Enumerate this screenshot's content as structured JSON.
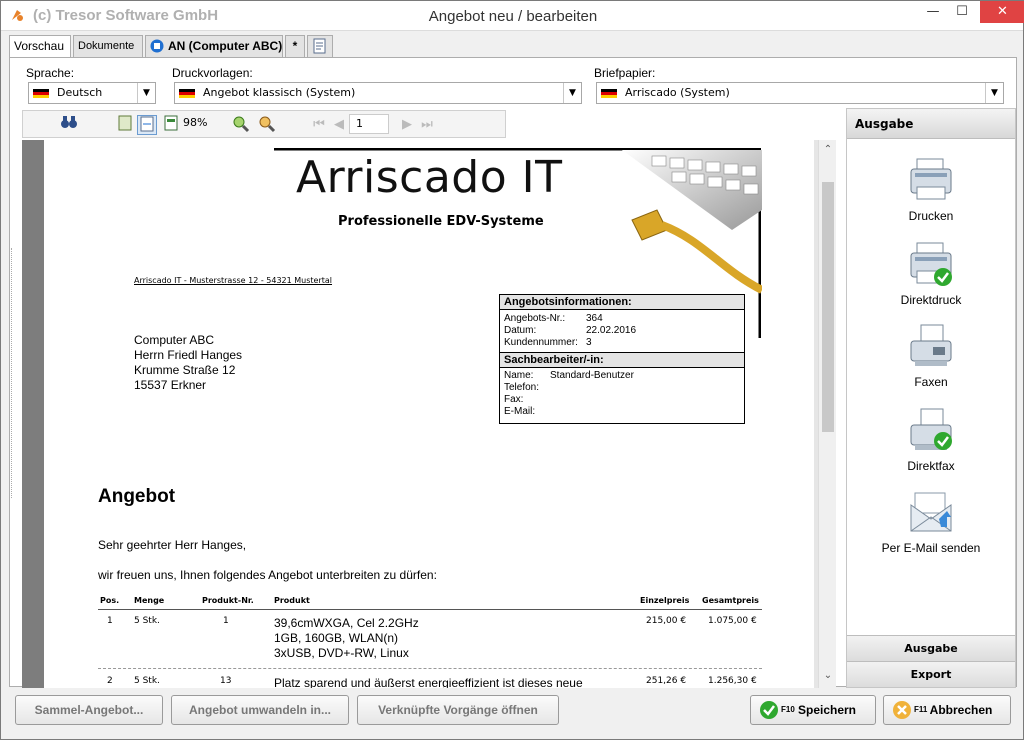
{
  "window": {
    "company": "(c) Tresor Software GmbH",
    "title": "Angebot neu / bearbeiten",
    "min": "—",
    "max": "☐",
    "close": "✕"
  },
  "tabs": [
    {
      "label": "Vorschau"
    },
    {
      "label": "Dokumente"
    },
    {
      "label": "AN (Computer ABC)"
    },
    {
      "label": "*"
    }
  ],
  "fields": {
    "sprache_label": "Sprache:",
    "sprache_value": "Deutsch",
    "druckvorlagen_label": "Druckvorlagen:",
    "druckvorlagen_value": "Angebot klassisch (System)",
    "briefpapier_label": "Briefpapier:",
    "briefpapier_value": "Arriscado (System)"
  },
  "toolbar": {
    "zoom": "98%",
    "page": "1"
  },
  "document": {
    "company_name": "Arriscado IT",
    "tagline": "Professionelle EDV-Systeme",
    "sender_line": "Arriscado IT - Musterstrasse 12 - 54321 Mustertal",
    "address": [
      "Computer ABC",
      "Herrn Friedl Hanges",
      "Krumme Straße 12",
      "15537 Erkner"
    ],
    "info_title": "Angebotsinformationen:",
    "info_rows": [
      {
        "label": "Angebots-Nr.:",
        "value": "364"
      },
      {
        "label": "Datum:",
        "value": "22.02.2016"
      },
      {
        "label": "Kundennummer:",
        "value": "3"
      }
    ],
    "contact_title": "Sachbearbeiter/-in:",
    "contact_rows": [
      {
        "label": "Name:",
        "value": "Standard-Benutzer"
      },
      {
        "label": "Telefon:",
        "value": ""
      },
      {
        "label": "Fax:",
        "value": ""
      },
      {
        "label": "E-Mail:",
        "value": ""
      }
    ],
    "heading": "Angebot",
    "salutation": "Sehr geehrter Herr Hanges,",
    "intro": "wir freuen uns, Ihnen folgendes Angebot unterbreiten zu dürfen:",
    "table_headers": {
      "pos": "Pos.",
      "menge": "Menge",
      "produkt_nr": "Produkt-Nr.",
      "produkt": "Produkt",
      "einzelpreis": "Einzelpreis",
      "gesamtpreis": "Gesamtpreis"
    },
    "rows": [
      {
        "pos": "1",
        "menge": "5 Stk.",
        "produkt_nr": "1",
        "produkt": [
          "39,6cmWXGA, Cel 2.2GHz",
          "1GB, 160GB, WLAN(n)",
          "3xUSB, DVD+-RW, Linux"
        ],
        "einzelpreis": "215,00 €",
        "gesamtpreis": "1.075,00 €"
      },
      {
        "pos": "2",
        "menge": "5 Stk.",
        "produkt_nr": "13",
        "produkt": [
          "Platz sparend und äußerst energieeffizient ist dieses neue"
        ],
        "einzelpreis": "251,26 €",
        "gesamtpreis": "1.256,30 €"
      }
    ]
  },
  "right_panel": {
    "header": "Ausgabe",
    "items": [
      {
        "label": "Drucken",
        "icon": "printer-icon"
      },
      {
        "label": "Direktdruck",
        "icon": "printer-check-icon"
      },
      {
        "label": "Faxen",
        "icon": "fax-icon"
      },
      {
        "label": "Direktfax",
        "icon": "fax-check-icon"
      },
      {
        "label": "Per E-Mail senden",
        "icon": "email-icon"
      }
    ],
    "footer_ausgabe": "Ausgabe",
    "footer_export": "Export"
  },
  "bottom": {
    "sammel": "Sammel-Angebot...",
    "umwandeln": "Angebot umwandeln in...",
    "verknuepfte": "Verknüpfte Vorgänge öffnen",
    "speichern_key": "F10",
    "speichern": "Speichern",
    "abbrechen_key": "F11",
    "abbrechen": "Abbrechen"
  },
  "colors": {
    "close_red": "#e04343",
    "check_green": "#2fa82f",
    "cancel_orange": "#f0b23a"
  }
}
